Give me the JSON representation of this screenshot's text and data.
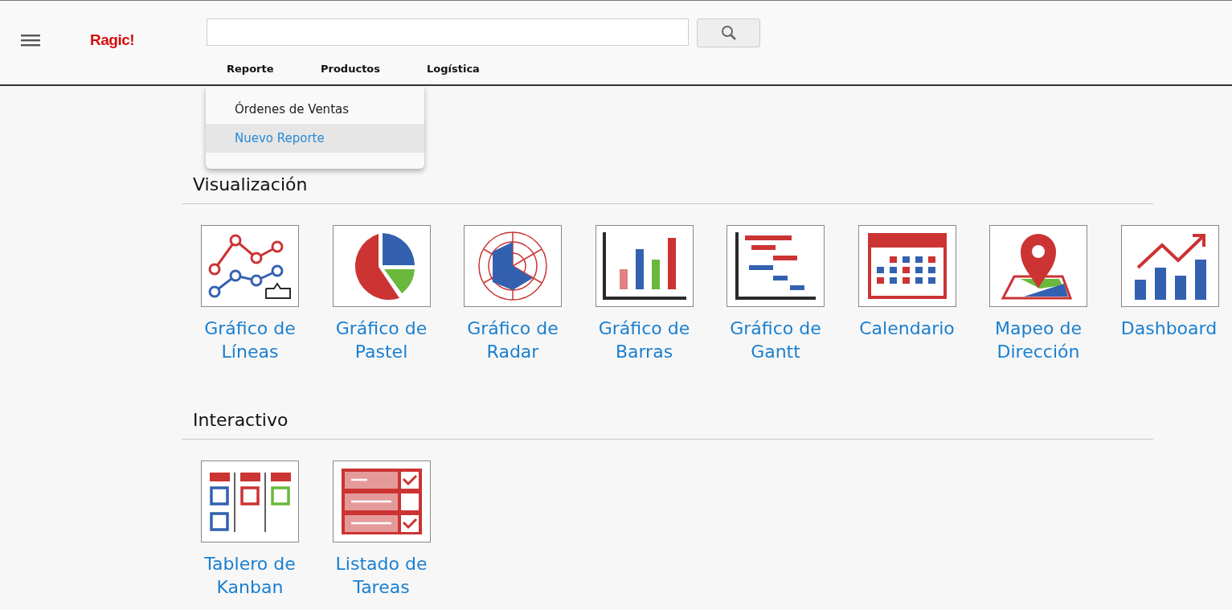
{
  "header": {
    "logo": "Ragic!",
    "nav": [
      {
        "label": "Reporte"
      },
      {
        "label": "Productos"
      },
      {
        "label": "Logística"
      }
    ]
  },
  "dropdown": {
    "items": [
      {
        "label": "Órdenes de Ventas",
        "selected": false
      },
      {
        "label": "Nuevo Reporte",
        "selected": true
      }
    ]
  },
  "sections": [
    {
      "title": "Visualización",
      "tiles": [
        {
          "kind": "line",
          "label": "Gráfico de Líneas"
        },
        {
          "kind": "pie",
          "label": "Gráfico de Pastel"
        },
        {
          "kind": "radar",
          "label": "Gráfico de Radar"
        },
        {
          "kind": "bar",
          "label": "Gráfico de Barras"
        },
        {
          "kind": "gantt",
          "label": "Gráfico de Gantt"
        },
        {
          "kind": "calendar",
          "label": "Calendario"
        },
        {
          "kind": "map",
          "label": "Mapeo de Dirección"
        },
        {
          "kind": "dashboard",
          "label": "Dashboard"
        }
      ]
    },
    {
      "title": "Interactivo",
      "tiles": [
        {
          "kind": "kanban",
          "label": "Tablero de Kanban"
        },
        {
          "kind": "tasks",
          "label": "Listado de Tareas"
        }
      ]
    }
  ]
}
